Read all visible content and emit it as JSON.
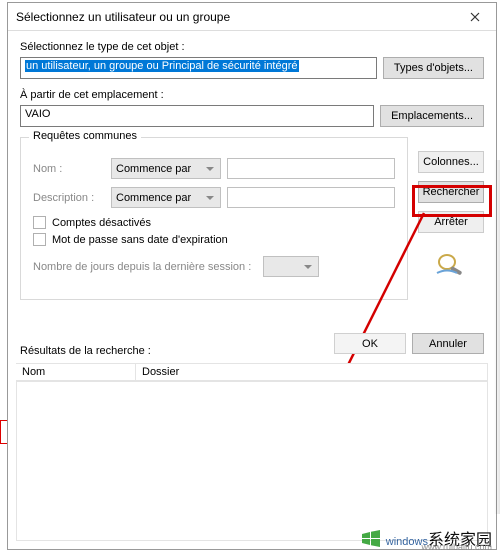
{
  "title": "Sélectionnez un utilisateur ou un groupe",
  "labels": {
    "objectType": "Sélectionnez le type de cet objet :",
    "objectValue": "un utilisateur, un groupe ou Principal de sécurité intégré",
    "fromLocation": "À partir de cet emplacement :",
    "locationValue": "VAIO",
    "commonQueries": "Requêtes communes",
    "name": "Nom :",
    "description": "Description :",
    "startsWith": "Commence par",
    "disabledAccounts": "Comptes désactivés",
    "noExpire": "Mot de passe sans date d'expiration",
    "daysSince": "Nombre de jours depuis la dernière session :",
    "results": "Résultats de la recherche :"
  },
  "buttons": {
    "objectTypes": "Types d'objets...",
    "locations": "Emplacements...",
    "columns": "Colonnes...",
    "search": "Rechercher",
    "stop": "Arrêter",
    "ok": "OK",
    "cancel": "Annuler"
  },
  "cols": {
    "name": "Nom",
    "folder": "Dossier"
  },
  "watermark": {
    "brand": "windows",
    "sub": "系统家园",
    "url": "www.ruibaitu.com"
  }
}
